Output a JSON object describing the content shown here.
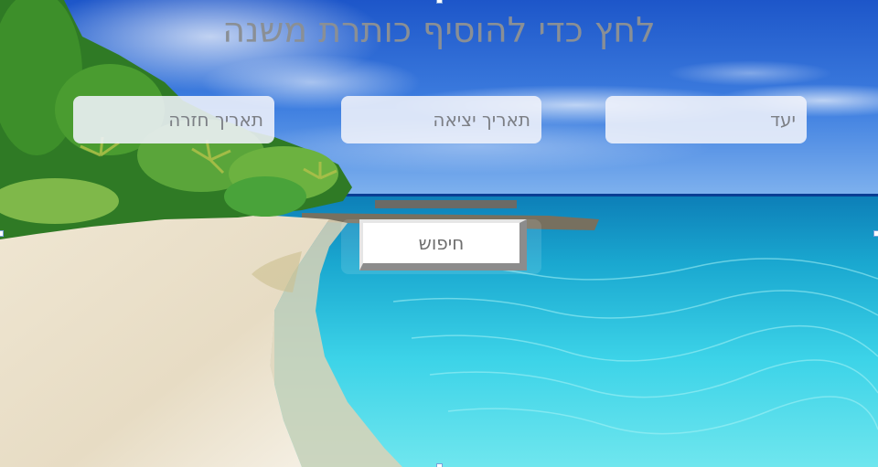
{
  "slide": {
    "title": "לחץ כדי להוסיף כותרת משנה",
    "fields": {
      "destination": "יעד",
      "departure_date": "תאריך יציאה",
      "return_date": "תאריך חזרה"
    },
    "search_button": "חיפוש"
  },
  "colors": {
    "title_text": "#8a8f95",
    "field_bg": "#f0f3fa",
    "button_shadow": "#8c8c8c"
  },
  "icons": {
    "background": "tropical-beach-photo"
  }
}
